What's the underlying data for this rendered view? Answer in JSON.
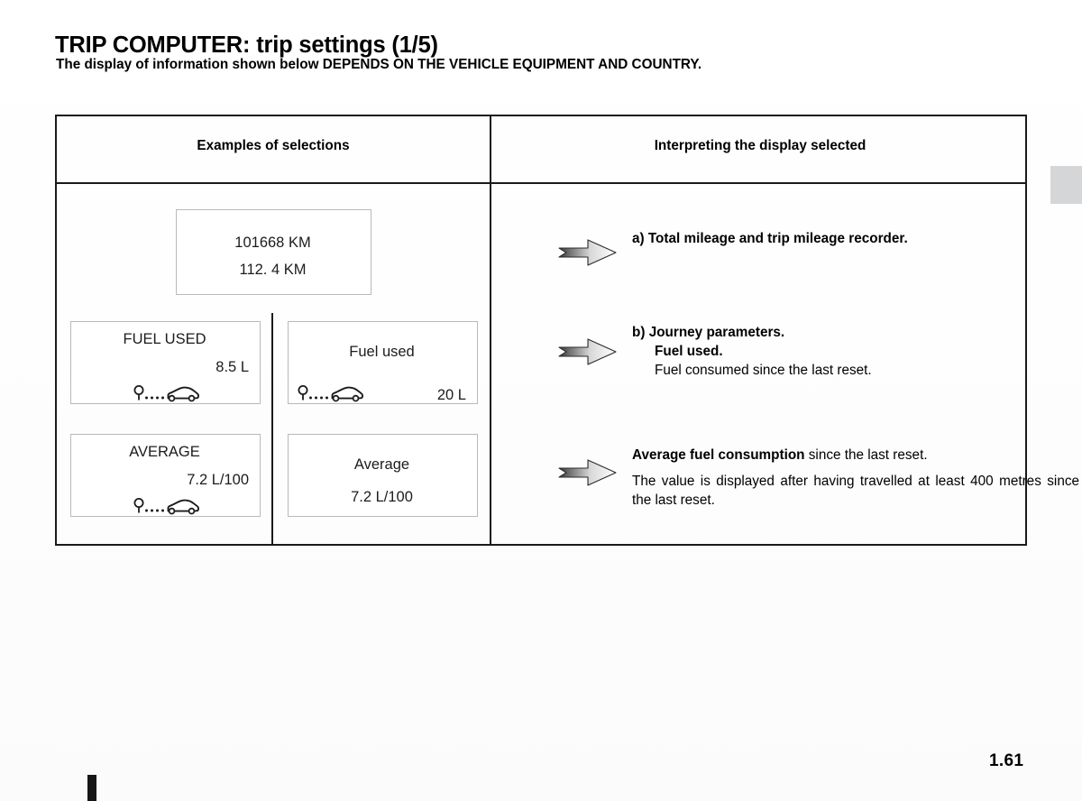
{
  "document": {
    "title": "TRIP COMPUTER: trip settings (1/5)",
    "subtitle": "The display of information shown below DEPENDS ON THE VEHICLE EQUIPMENT AND COUNTRY.",
    "page_number": "1.61"
  },
  "table": {
    "headers": {
      "left": "Examples of selections",
      "right": "Interpreting the display selected"
    }
  },
  "displays": {
    "odometer": {
      "total_mileage": "101668 KM",
      "trip_mileage": "112. 4 KM"
    },
    "fuel_used_upper": {
      "label": "FUEL USED",
      "value": "8.5 L",
      "icon": "trip-distance-car-icon"
    },
    "fuel_used_lower": {
      "label": "Fuel used",
      "value": "20 L",
      "icon": "trip-distance-car-icon"
    },
    "average_upper": {
      "label": "AVERAGE",
      "value": "7.2 L/100",
      "icon": "trip-distance-car-icon"
    },
    "average_lower": {
      "label": "Average",
      "value": "7.2 L/100"
    }
  },
  "explanations": {
    "a": {
      "arrow_icon": "right-arrow-icon",
      "text": "a) Total mileage and trip mileage recorder."
    },
    "b": {
      "arrow_icon": "right-arrow-icon",
      "heading": "b) Journey parameters.",
      "subheading": "Fuel used.",
      "body": "Fuel consumed since the last reset."
    },
    "c": {
      "arrow_icon": "right-arrow-icon",
      "lead_bold": "Average fuel consumption",
      "lead_rest": " since the last reset.",
      "body": "The value is displayed after having travelled at least 400 metres since the last reset."
    }
  },
  "colors": {
    "background": "#fdfdfd",
    "table_border": "#1a1a1a",
    "lcd_border": "#b9b9b9",
    "edge_tab": "#d5d6d8",
    "corner_mark": "#161616",
    "text": "#000000"
  }
}
